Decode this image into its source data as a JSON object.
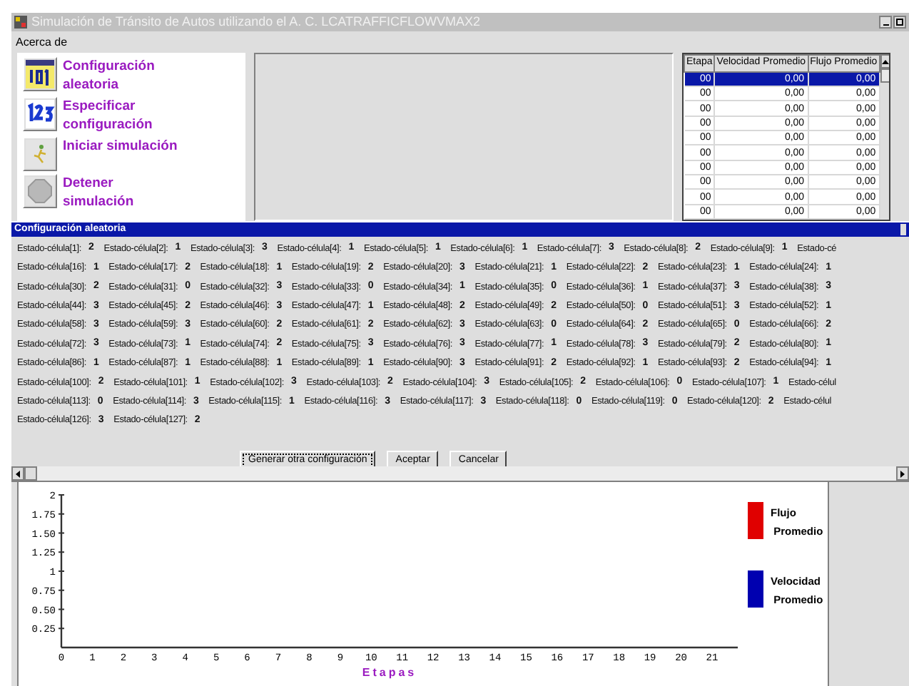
{
  "window": {
    "title": "Simulación de Tránsito de Autos utilizando el A. C. LCATRAFFICFLOWVMAX2"
  },
  "menu": [
    {
      "label": "Acerca de"
    }
  ],
  "actions": [
    {
      "label": "Configuración aleatoria",
      "kind": "random"
    },
    {
      "label": "Especificar configuración",
      "kind": "specify"
    },
    {
      "label": "Iniciar simulación",
      "kind": "start"
    },
    {
      "label": "Detener simulación",
      "kind": "stop"
    }
  ],
  "table": {
    "columns": [
      "Etapa",
      "Velocidad Promedio",
      "Flujo Promedio"
    ],
    "rows": [
      {
        "cells": [
          "00",
          "0,00",
          "0,00"
        ],
        "selected": true
      },
      {
        "cells": [
          "00",
          "0,00",
          "0,00"
        ],
        "selected": false
      },
      {
        "cells": [
          "00",
          "0,00",
          "0,00"
        ],
        "selected": false
      },
      {
        "cells": [
          "00",
          "0,00",
          "0,00"
        ],
        "selected": false
      },
      {
        "cells": [
          "00",
          "0,00",
          "0,00"
        ],
        "selected": false
      },
      {
        "cells": [
          "00",
          "0,00",
          "0,00"
        ],
        "selected": false
      },
      {
        "cells": [
          "00",
          "0,00",
          "0,00"
        ],
        "selected": false
      },
      {
        "cells": [
          "00",
          "0,00",
          "0,00"
        ],
        "selected": false
      },
      {
        "cells": [
          "00",
          "0,00",
          "0,00"
        ],
        "selected": false
      },
      {
        "cells": [
          "00",
          "0,00",
          "0,00"
        ],
        "selected": false
      }
    ]
  },
  "dialog": {
    "title": "Configuración aleatoria",
    "rows": [
      {
        "cells": [
          [
            "Estado-célula[1]:",
            "2"
          ],
          [
            "Estado-célula[2]:",
            "1"
          ],
          [
            "Estado-célula[3]:",
            "3"
          ],
          [
            "Estado-célula[4]:",
            "1"
          ],
          [
            "Estado-célula[5]:",
            "1"
          ],
          [
            "Estado-célula[6]:",
            "1"
          ],
          [
            "Estado-célula[7]:",
            "3"
          ],
          [
            "Estado-célula[8]:",
            "2"
          ],
          [
            "Estado-célula[9]:",
            "1"
          ]
        ],
        "cut": "Estado-cé"
      },
      {
        "cells": [
          [
            "Estado-célula[16]:",
            "1"
          ],
          [
            "Estado-célula[17]:",
            "2"
          ],
          [
            "Estado-célula[18]:",
            "1"
          ],
          [
            "Estado-célula[19]:",
            "2"
          ],
          [
            "Estado-célula[20]:",
            "3"
          ],
          [
            "Estado-célula[21]:",
            "1"
          ],
          [
            "Estado-célula[22]:",
            "2"
          ],
          [
            "Estado-célula[23]:",
            "1"
          ],
          [
            "Estado-célula[24]:",
            "1"
          ]
        ]
      },
      {
        "cells": [
          [
            "Estado-célula[30]:",
            "2"
          ],
          [
            "Estado-célula[31]:",
            "0"
          ],
          [
            "Estado-célula[32]:",
            "3"
          ],
          [
            "Estado-célula[33]:",
            "0"
          ],
          [
            "Estado-célula[34]:",
            "1"
          ],
          [
            "Estado-célula[35]:",
            "0"
          ],
          [
            "Estado-célula[36]:",
            "1"
          ],
          [
            "Estado-célula[37]:",
            "3"
          ],
          [
            "Estado-célula[38]:",
            "3"
          ]
        ]
      },
      {
        "cells": [
          [
            "Estado-célula[44]:",
            "3"
          ],
          [
            "Estado-célula[45]:",
            "2"
          ],
          [
            "Estado-célula[46]:",
            "3"
          ],
          [
            "Estado-célula[47]:",
            "1"
          ],
          [
            "Estado-célula[48]:",
            "2"
          ],
          [
            "Estado-célula[49]:",
            "2"
          ],
          [
            "Estado-célula[50]:",
            "0"
          ],
          [
            "Estado-célula[51]:",
            "3"
          ],
          [
            "Estado-célula[52]:",
            "1"
          ]
        ]
      },
      {
        "cells": [
          [
            "Estado-célula[58]:",
            "3"
          ],
          [
            "Estado-célula[59]:",
            "3"
          ],
          [
            "Estado-célula[60]:",
            "2"
          ],
          [
            "Estado-célula[61]:",
            "2"
          ],
          [
            "Estado-célula[62]:",
            "3"
          ],
          [
            "Estado-célula[63]:",
            "0"
          ],
          [
            "Estado-célula[64]:",
            "2"
          ],
          [
            "Estado-célula[65]:",
            "0"
          ],
          [
            "Estado-célula[66]:",
            "2"
          ]
        ]
      },
      {
        "cells": [
          [
            "Estado-célula[72]:",
            "3"
          ],
          [
            "Estado-célula[73]:",
            "1"
          ],
          [
            "Estado-célula[74]:",
            "2"
          ],
          [
            "Estado-célula[75]:",
            "3"
          ],
          [
            "Estado-célula[76]:",
            "3"
          ],
          [
            "Estado-célula[77]:",
            "1"
          ],
          [
            "Estado-célula[78]:",
            "3"
          ],
          [
            "Estado-célula[79]:",
            "2"
          ],
          [
            "Estado-célula[80]:",
            "1"
          ]
        ]
      },
      {
        "cells": [
          [
            "Estado-célula[86]:",
            "1"
          ],
          [
            "Estado-célula[87]:",
            "1"
          ],
          [
            "Estado-célula[88]:",
            "1"
          ],
          [
            "Estado-célula[89]:",
            "1"
          ],
          [
            "Estado-célula[90]:",
            "3"
          ],
          [
            "Estado-célula[91]:",
            "2"
          ],
          [
            "Estado-célula[92]:",
            "1"
          ],
          [
            "Estado-célula[93]:",
            "2"
          ],
          [
            "Estado-célula[94]:",
            "1"
          ]
        ]
      },
      {
        "cells": [
          [
            "Estado-célula[100]:",
            "2"
          ],
          [
            "Estado-célula[101]:",
            "1"
          ],
          [
            "Estado-célula[102]:",
            "3"
          ],
          [
            "Estado-célula[103]:",
            "2"
          ],
          [
            "Estado-célula[104]:",
            "3"
          ],
          [
            "Estado-célula[105]:",
            "2"
          ],
          [
            "Estado-célula[106]:",
            "0"
          ],
          [
            "Estado-célula[107]:",
            "1"
          ]
        ],
        "cut": "Estado-célul"
      },
      {
        "cells": [
          [
            "Estado-célula[113]:",
            "0"
          ],
          [
            "Estado-célula[114]:",
            "3"
          ],
          [
            "Estado-célula[115]:",
            "1"
          ],
          [
            "Estado-célula[116]:",
            "3"
          ],
          [
            "Estado-célula[117]:",
            "3"
          ],
          [
            "Estado-célula[118]:",
            "0"
          ],
          [
            "Estado-célula[119]:",
            "0"
          ],
          [
            "Estado-célula[120]:",
            "2"
          ]
        ],
        "cut": "Estado-célul"
      },
      {
        "cells": [
          [
            "Estado-célula[126]:",
            "3"
          ],
          [
            "Estado-célula[127]:",
            "2"
          ]
        ]
      }
    ],
    "buttons": [
      {
        "label": "Generar otra configuración",
        "focused": true
      },
      {
        "label": "Aceptar",
        "focused": false
      },
      {
        "label": "Cancelar",
        "focused": false
      }
    ]
  },
  "chart": {
    "xlabel": "Etapas",
    "x_ticks": [
      "0",
      "1",
      "2",
      "3",
      "4",
      "5",
      "6",
      "7",
      "8",
      "9",
      "10",
      "11",
      "12",
      "13",
      "14",
      "15",
      "16",
      "17",
      "18",
      "19",
      "20",
      "21"
    ],
    "y_ticks": [
      "2",
      "1.75",
      "1.50",
      "1.25",
      "1",
      "0.75",
      "0.50",
      "0.25"
    ],
    "legend": [
      {
        "label": "Flujo Promedio",
        "color": "#e00000"
      },
      {
        "label": "Velocidad Promedio",
        "color": "#0000b0"
      }
    ]
  }
}
